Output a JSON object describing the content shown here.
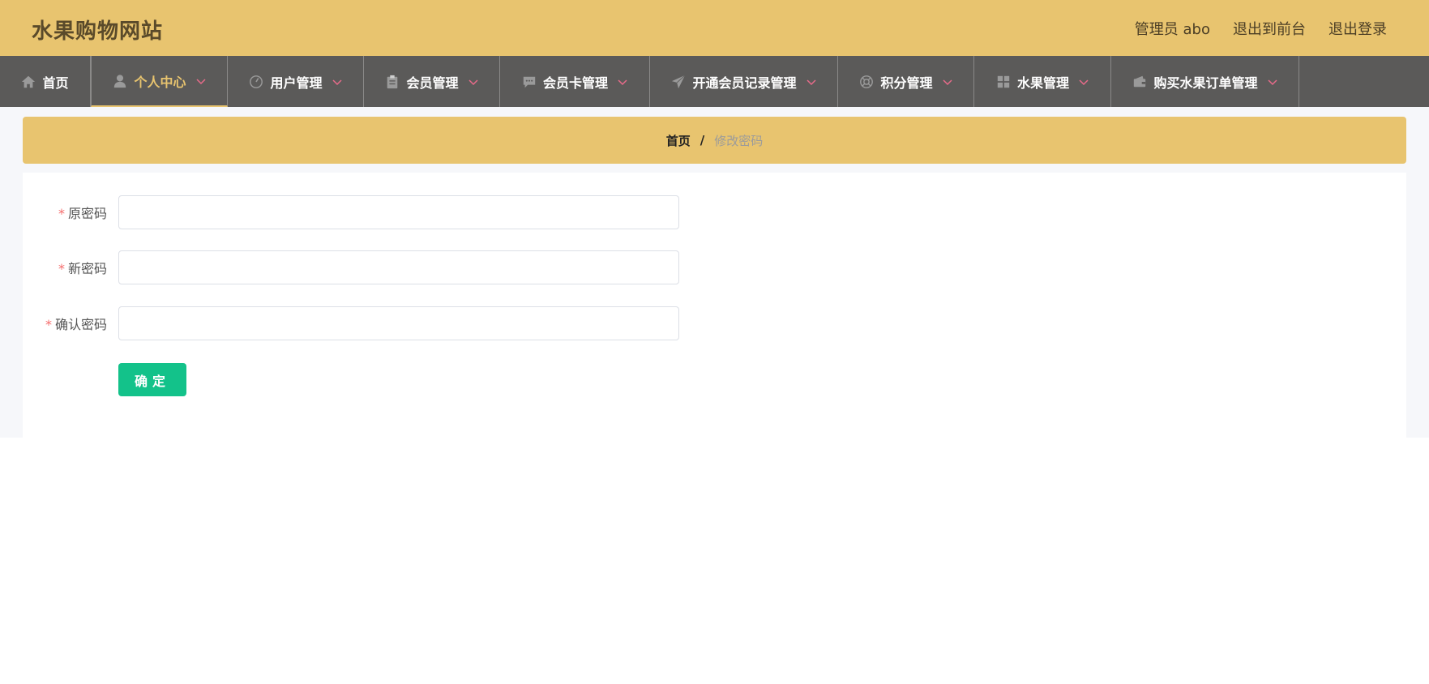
{
  "header": {
    "title": "水果购物网站",
    "user_label": "管理员 abo",
    "to_front_label": "退出到前台",
    "logout_label": "退出登录",
    "bg_color": "#e8c46f"
  },
  "nav": {
    "items": [
      {
        "label": "首页",
        "icon": "home-icon"
      },
      {
        "label": "个人中心",
        "icon": "user-icon",
        "active": true
      },
      {
        "label": "用户管理",
        "icon": "gauge-icon"
      },
      {
        "label": "会员管理",
        "icon": "clipboard-icon"
      },
      {
        "label": "会员卡管理",
        "icon": "chat-icon"
      },
      {
        "label": "开通会员记录管理",
        "icon": "paper-plane-icon"
      },
      {
        "label": "积分管理",
        "icon": "lifebuoy-icon"
      },
      {
        "label": "水果管理",
        "icon": "grid-icon"
      },
      {
        "label": "购买水果订单管理",
        "icon": "wallet-icon"
      }
    ],
    "bg_color": "#5b5a59",
    "active_color": "#e8c46f",
    "caret_color": "#e86b8a"
  },
  "breadcrumb": {
    "home": "首页",
    "separator": "/",
    "current": "修改密码"
  },
  "form": {
    "required_mark": "*",
    "old_password_label": "原密码",
    "old_password_value": "",
    "new_password_label": "新密码",
    "new_password_value": "",
    "confirm_password_label": "确认密码",
    "confirm_password_value": "",
    "submit_label": "确定",
    "submit_color": "#13c28a"
  }
}
